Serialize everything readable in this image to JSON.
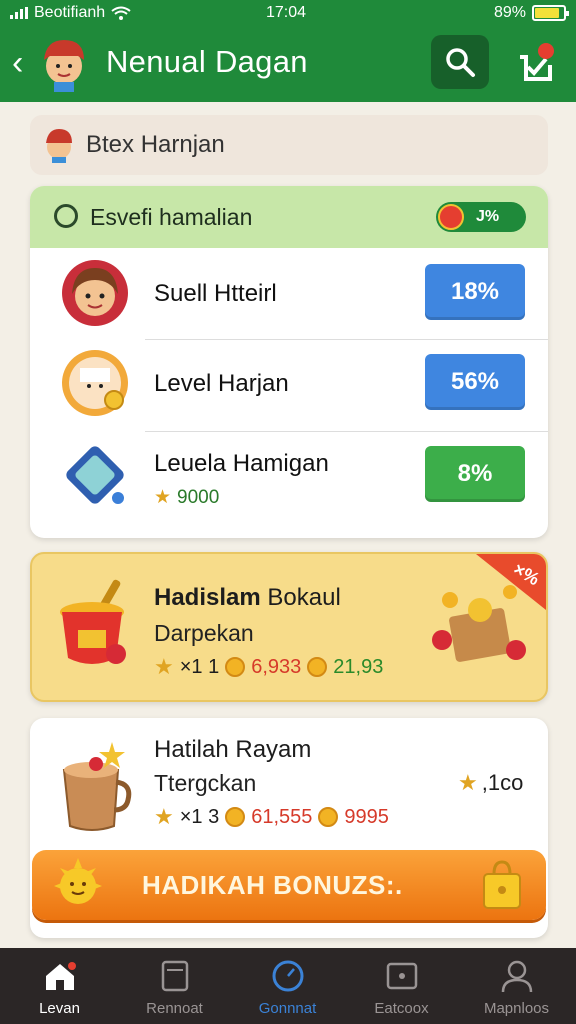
{
  "status": {
    "carrier": "Beotifianh",
    "time": "17:04",
    "battery": "89%"
  },
  "header": {
    "title": "Nenual Dagan",
    "avatar_icon": "character-avatar-icon",
    "search_icon": "search-icon",
    "bell_icon": "notification-icon",
    "notification_dot_color": "#e53e30"
  },
  "strip": {
    "label": "Btex Harnjan"
  },
  "card1": {
    "header_label": "Esvefi hamalian",
    "badge": "J%",
    "rows": [
      {
        "label": "Suell Htteirl",
        "percent": "18%",
        "color": "#3f86e0",
        "icon": "girl-avatar-icon"
      },
      {
        "label": "Level Harjan",
        "percent": "56%",
        "color": "#3f86e0",
        "icon": "character-coin-icon"
      },
      {
        "label": "Leuela Hamigan",
        "sub": "9000",
        "percent": "8%",
        "color": "#3cae4a",
        "icon": "gem-icon"
      }
    ]
  },
  "card2": {
    "title_bold": "Hadislam",
    "title_rest": " Bokaul",
    "subtitle": "Darpekan",
    "stat1": "×1 1",
    "stat2": "6,933",
    "stat3": "21,93",
    "ribbon": "×%"
  },
  "card3": {
    "title": "Hatilah Rayam",
    "subtitle": "Ttergckan",
    "stat1": "×1 3",
    "stat2": "61,555",
    "stat3": "9995",
    "reward": ",1co",
    "button": "HADIKAH BONUZS:."
  },
  "nav": [
    {
      "label": "Levan",
      "icon": "home-icon"
    },
    {
      "label": "Rennoat",
      "icon": "tablet-icon"
    },
    {
      "label": "Gonnnat",
      "icon": "clock-icon"
    },
    {
      "label": "Eatcoox",
      "icon": "game-box-icon"
    },
    {
      "label": "Mapnloos",
      "icon": "profile-icon"
    }
  ]
}
